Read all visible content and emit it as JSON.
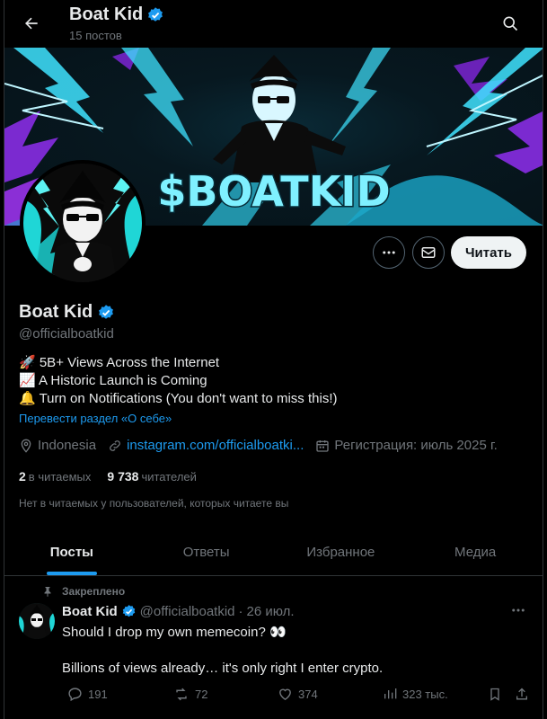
{
  "header": {
    "name": "Boat Kid",
    "posts_count": "15 постов"
  },
  "banner": {
    "title": "$BOATKID"
  },
  "profile": {
    "name": "Boat Kid",
    "handle": "@officialboatkid",
    "bio": [
      "🚀 5B+ Views Across the Internet",
      "📈 A Historic Launch is Coming",
      "🔔 Turn on Notifications (You don't want to miss this!)"
    ],
    "translate_link": "Перевести раздел «О себе»",
    "location": "Indonesia",
    "website": "instagram.com/officialboatki...",
    "joined": "Регистрация: июль 2025 г.",
    "following_count": "2",
    "following_label": "в читаемых",
    "followers_count": "9 738",
    "followers_label": "читателей",
    "followers_note": "Нет в читаемых у пользователей, которых читаете вы"
  },
  "actions": {
    "follow_label": "Читать"
  },
  "tabs": [
    {
      "label": "Посты",
      "active": true
    },
    {
      "label": "Ответы",
      "active": false
    },
    {
      "label": "Избранное",
      "active": false
    },
    {
      "label": "Медиа",
      "active": false
    }
  ],
  "pinned_post": {
    "pinned_label": "Закреплено",
    "author_name": "Boat Kid",
    "author_handle": "@officialboatkid",
    "separator": "·",
    "date": "26 июл.",
    "text_line1": "Should I drop my own memecoin? 👀",
    "text_line2": "Billions of views already… it's only right I enter crypto.",
    "replies": "191",
    "reposts": "72",
    "likes": "374",
    "views": "323 тыс."
  },
  "colors": {
    "accent": "#1d9bf0",
    "background": "#000000",
    "muted": "#71767b",
    "banner_cyan": "#3fe3ff",
    "banner_purple": "#8b2fd6"
  }
}
